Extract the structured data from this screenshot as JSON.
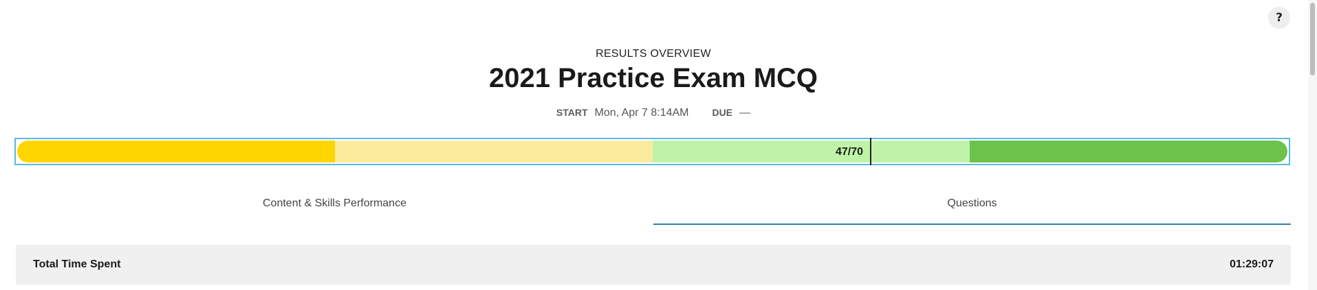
{
  "help": {
    "label": "?"
  },
  "header": {
    "eyebrow": "RESULTS OVERVIEW",
    "title": "2021 Practice Exam MCQ",
    "start_key": "START",
    "start_value": "Mon, Apr 7 8:14AM",
    "due_key": "DUE",
    "due_value": "—"
  },
  "progress": {
    "score_text": "47/70",
    "score_value": 47,
    "score_max": 70,
    "segments": [
      {
        "fraction": 0.25,
        "color": "#fdd600"
      },
      {
        "fraction": 0.25,
        "color": "#fdeb9d"
      },
      {
        "fraction": 0.25,
        "color": "#bff4a8"
      },
      {
        "fraction": 0.25,
        "color": "#6cc24a"
      }
    ]
  },
  "tabs": [
    {
      "label": "Content & Skills Performance",
      "active": false
    },
    {
      "label": "Questions",
      "active": true
    }
  ],
  "summary": {
    "label": "Total Time Spent",
    "value": "01:29:07"
  }
}
